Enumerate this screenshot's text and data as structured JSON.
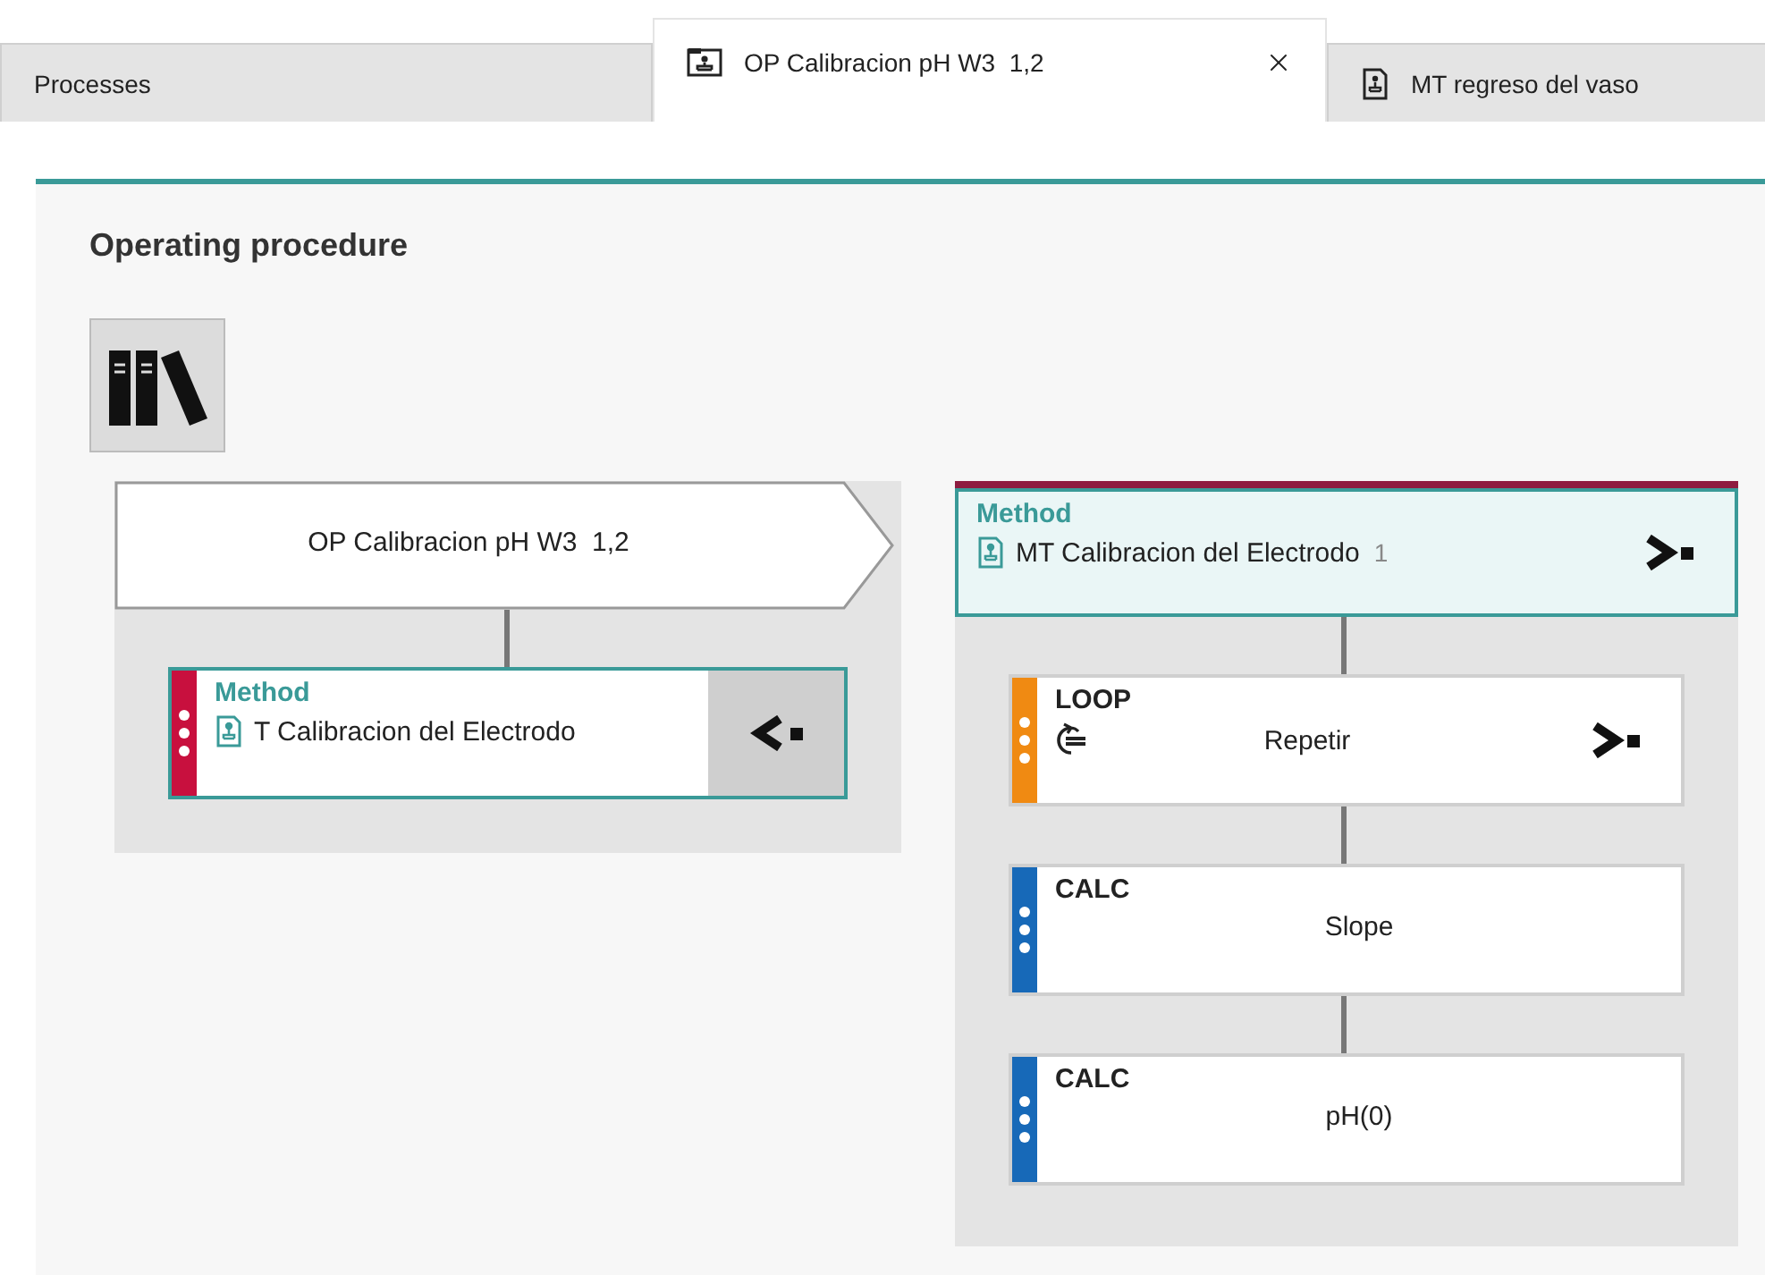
{
  "tabs": [
    {
      "label": "Processes",
      "kind": "plain",
      "selected": false
    },
    {
      "label": "OP Calibracion pH W3  1,2",
      "kind": "procedure",
      "selected": true
    },
    {
      "label": "MT regreso del vaso",
      "kind": "method",
      "selected": false
    }
  ],
  "heading": "Operating procedure",
  "procedure": {
    "title": "OP Calibracion pH W3  1,2",
    "method": {
      "type": "Method",
      "name": "T Calibracion del Electrodo",
      "color": "#c8103e",
      "expanded": true
    }
  },
  "method": {
    "type": "Method",
    "name": "MT Calibracion del Electrodo",
    "version": "1",
    "expanded": false,
    "steps": [
      {
        "kind": "loop",
        "type": "LOOP",
        "name": "Repetir",
        "color": "#f08a12",
        "expanded": false
      },
      {
        "kind": "calc",
        "type": "CALC",
        "name": "Slope",
        "color": "#1769b8"
      },
      {
        "kind": "calc",
        "type": "CALC",
        "name": "pH(0)",
        "color": "#1769b8"
      }
    ]
  }
}
